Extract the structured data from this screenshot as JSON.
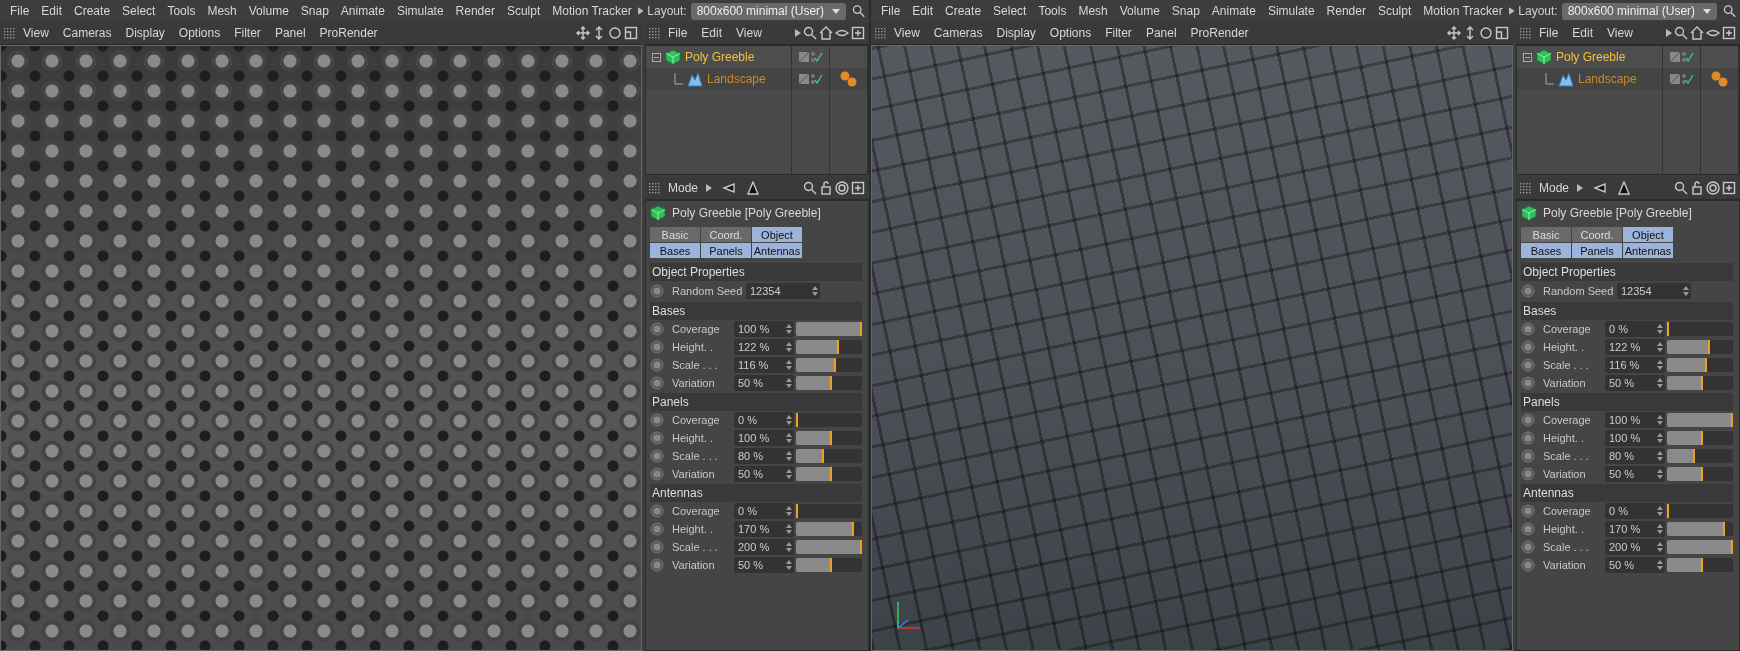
{
  "windows": [
    {
      "menu": [
        "File",
        "Edit",
        "Create",
        "Select",
        "Tools",
        "Mesh",
        "Volume",
        "Snap",
        "Animate",
        "Simulate",
        "Render",
        "Sculpt",
        "Motion Tracker"
      ],
      "layout": {
        "label": "Layout:",
        "value": "800x600 minimal (User)"
      },
      "viewport": {
        "kind": "greeble",
        "menu": [
          "View",
          "Cameras",
          "Display",
          "Options",
          "Filter",
          "Panel",
          "ProRender"
        ]
      },
      "object_manager": {
        "menu": [
          "File",
          "Edit",
          "View"
        ],
        "objects": [
          {
            "name": "Poly Greeble",
            "selected": true,
            "children": [
              {
                "name": "Landscape",
                "selected": false
              }
            ]
          }
        ]
      },
      "attributes": {
        "mode": "Mode",
        "title": "Poly Greeble [Poly Greeble]",
        "tabs": [
          {
            "label": "Basic",
            "selected": false
          },
          {
            "label": "Coord.",
            "selected": false
          },
          {
            "label": "Object",
            "selected": true
          },
          {
            "label": "Bases",
            "selected": true
          },
          {
            "label": "Panels",
            "selected": true
          },
          {
            "label": "Antennas",
            "selected": true
          }
        ],
        "groups": [
          {
            "title": "Object Properties",
            "params": [
              {
                "kind": "number",
                "label": "Random Seed",
                "value": "12354"
              }
            ]
          },
          {
            "title": "Bases",
            "params": [
              {
                "kind": "slider",
                "label": "Coverage",
                "value": "100 %",
                "level": 1
              },
              {
                "kind": "slider",
                "label": "Height. .",
                "value": "122 %",
                "level": 0.64
              },
              {
                "kind": "slider",
                "label": "Scale . . .",
                "value": "116 %",
                "level": 0.59
              },
              {
                "kind": "slider",
                "label": "Variation",
                "value": "50 %",
                "level": 0.53
              }
            ]
          },
          {
            "title": "Panels",
            "params": [
              {
                "kind": "slider",
                "label": "Coverage",
                "value": "0 %",
                "level": 0
              },
              {
                "kind": "slider",
                "label": "Height. .",
                "value": "100 %",
                "level": 0.53
              },
              {
                "kind": "slider",
                "label": "Scale . . .",
                "value": "80 %",
                "level": 0.41
              },
              {
                "kind": "slider",
                "label": "Variation",
                "value": "50 %",
                "level": 0.53
              }
            ]
          },
          {
            "title": "Antennas",
            "params": [
              {
                "kind": "slider",
                "label": "Coverage",
                "value": "0 %",
                "level": 0
              },
              {
                "kind": "slider",
                "label": "Height. .",
                "value": "170 %",
                "level": 0.88
              },
              {
                "kind": "slider",
                "label": "Scale . . .",
                "value": "200 %",
                "level": 1
              },
              {
                "kind": "slider",
                "label": "Variation",
                "value": "50 %",
                "level": 0.53
              }
            ]
          }
        ]
      }
    },
    {
      "menu": [
        "File",
        "Edit",
        "Create",
        "Select",
        "Tools",
        "Mesh",
        "Volume",
        "Snap",
        "Animate",
        "Simulate",
        "Render",
        "Sculpt",
        "Motion Tracker"
      ],
      "layout": {
        "label": "Layout:",
        "value": "800x600 minimal (User)"
      },
      "viewport": {
        "kind": "panels",
        "menu": [
          "View",
          "Cameras",
          "Display",
          "Options",
          "Filter",
          "Panel",
          "ProRender"
        ]
      },
      "object_manager": {
        "menu": [
          "File",
          "Edit",
          "View"
        ],
        "objects": [
          {
            "name": "Poly Greeble",
            "selected": true,
            "children": [
              {
                "name": "Landscape",
                "selected": false
              }
            ]
          }
        ]
      },
      "attributes": {
        "mode": "Mode",
        "title": "Poly Greeble [Poly Greeble]",
        "tabs": [
          {
            "label": "Basic",
            "selected": false
          },
          {
            "label": "Coord.",
            "selected": false
          },
          {
            "label": "Object",
            "selected": true
          },
          {
            "label": "Bases",
            "selected": true
          },
          {
            "label": "Panels",
            "selected": true
          },
          {
            "label": "Antennas",
            "selected": true
          }
        ],
        "groups": [
          {
            "title": "Object Properties",
            "params": [
              {
                "kind": "number",
                "label": "Random Seed",
                "value": "12354"
              }
            ]
          },
          {
            "title": "Bases",
            "params": [
              {
                "kind": "slider",
                "label": "Coverage",
                "value": "0 %",
                "level": 0
              },
              {
                "kind": "slider",
                "label": "Height. .",
                "value": "122 %",
                "level": 0.64
              },
              {
                "kind": "slider",
                "label": "Scale . . .",
                "value": "116 %",
                "level": 0.59
              },
              {
                "kind": "slider",
                "label": "Variation",
                "value": "50 %",
                "level": 0.53
              }
            ]
          },
          {
            "title": "Panels",
            "params": [
              {
                "kind": "slider",
                "label": "Coverage",
                "value": "100 %",
                "level": 1
              },
              {
                "kind": "slider",
                "label": "Height. .",
                "value": "100 %",
                "level": 0.53
              },
              {
                "kind": "slider",
                "label": "Scale . . .",
                "value": "80 %",
                "level": 0.41
              },
              {
                "kind": "slider",
                "label": "Variation",
                "value": "50 %",
                "level": 0.53
              }
            ]
          },
          {
            "title": "Antennas",
            "params": [
              {
                "kind": "slider",
                "label": "Coverage",
                "value": "0 %",
                "level": 0
              },
              {
                "kind": "slider",
                "label": "Height. .",
                "value": "170 %",
                "level": 0.88
              },
              {
                "kind": "slider",
                "label": "Scale . . .",
                "value": "200 %",
                "level": 1
              },
              {
                "kind": "slider",
                "label": "Variation",
                "value": "50 %",
                "level": 0.53
              }
            ]
          }
        ]
      }
    }
  ]
}
